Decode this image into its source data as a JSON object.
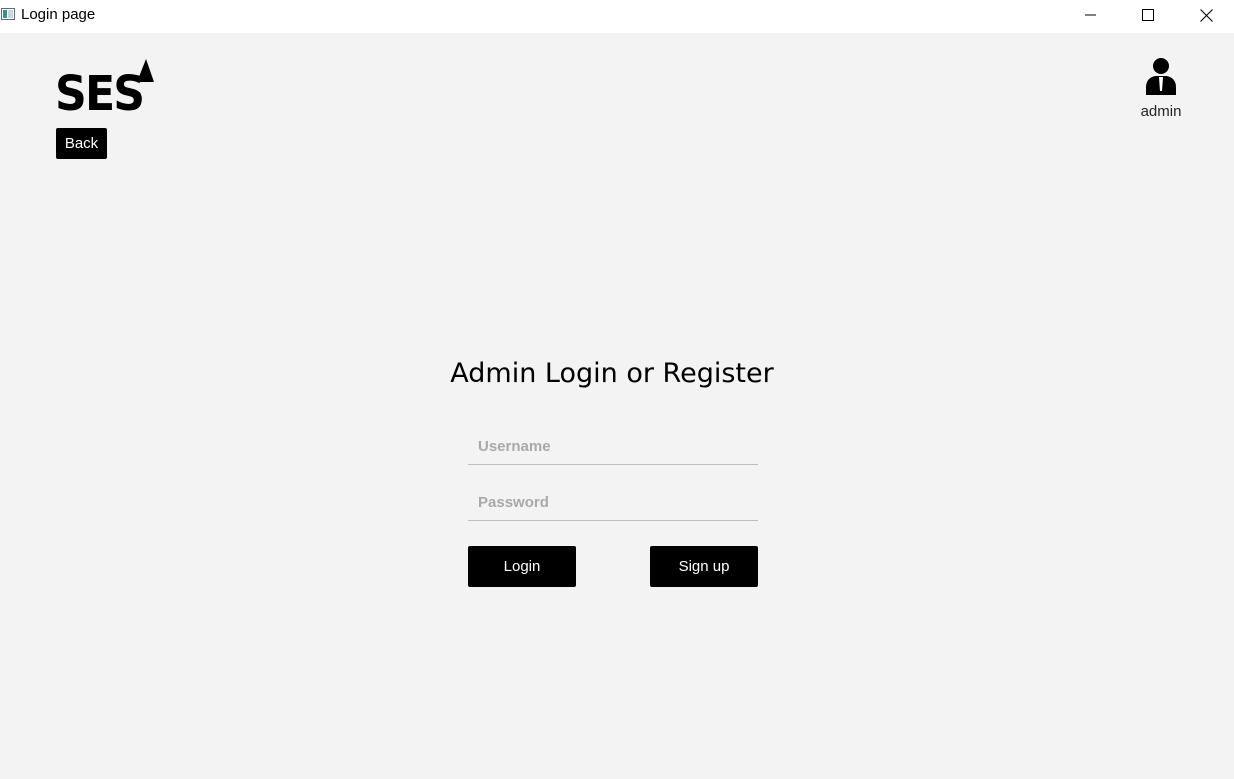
{
  "window": {
    "title": "Login page",
    "app_icon": "app-window-icon",
    "controls": [
      "minimize-icon",
      "maximize-icon",
      "close-icon"
    ]
  },
  "header": {
    "logo_text": "SES",
    "back_label": "Back",
    "user_icon": "user-icon",
    "user_label": "admin"
  },
  "form": {
    "title": "Admin Login or Register",
    "username": {
      "value": "",
      "placeholder": "Username"
    },
    "password": {
      "value": "",
      "placeholder": "Password"
    },
    "login_label": "Login",
    "signup_label": "Sign up"
  },
  "colors": {
    "background": "#f3f3f3",
    "button": "#000000",
    "button_text": "#ffffff",
    "placeholder": "#a9a9a9"
  }
}
